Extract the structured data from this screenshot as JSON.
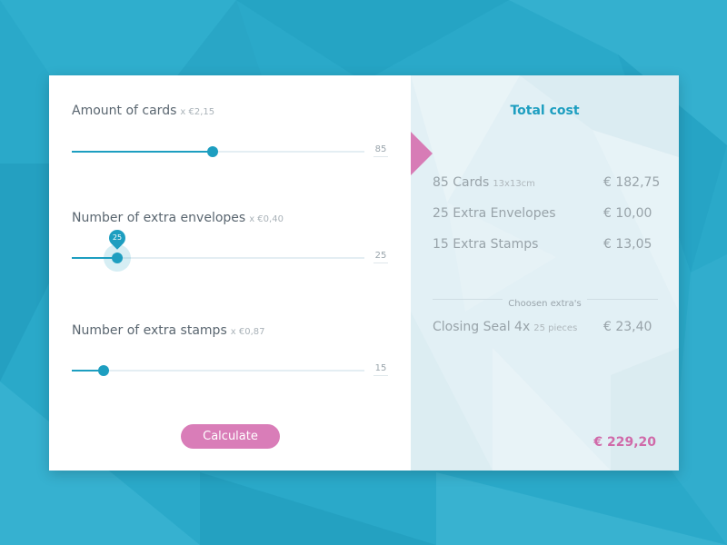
{
  "colors": {
    "background": "#2aa9c9",
    "accent": "#1d9ec0",
    "pink": "#d97db8",
    "summary_panel": "#e2f0f5"
  },
  "sliders": [
    {
      "label": "Amount of cards",
      "price": "x €2,15",
      "value": "85",
      "fraction": 0.48,
      "active": false
    },
    {
      "label": "Number of extra envelopes",
      "price": "x €0,40",
      "value": "25",
      "fraction": 0.155,
      "active": true
    },
    {
      "label": "Number of extra stamps",
      "price": "x €0,87",
      "value": "15",
      "fraction": 0.11,
      "active": false
    }
  ],
  "calculate_label": "Calculate",
  "summary": {
    "title": "Total cost",
    "lines": [
      {
        "name": "85 Cards",
        "sub": "13x13cm",
        "amount": "€ 182,75"
      },
      {
        "name": "25 Extra Envelopes",
        "sub": "",
        "amount": "€ 10,00"
      },
      {
        "name": "15 Extra Stamps",
        "sub": "",
        "amount": "€ 13,05"
      }
    ],
    "extras_label": "Choosen extra's",
    "extras": [
      {
        "name": "Closing Seal 4x",
        "sub": "25 pieces",
        "amount": "€ 23,40"
      }
    ],
    "total": "€ 229,20"
  }
}
